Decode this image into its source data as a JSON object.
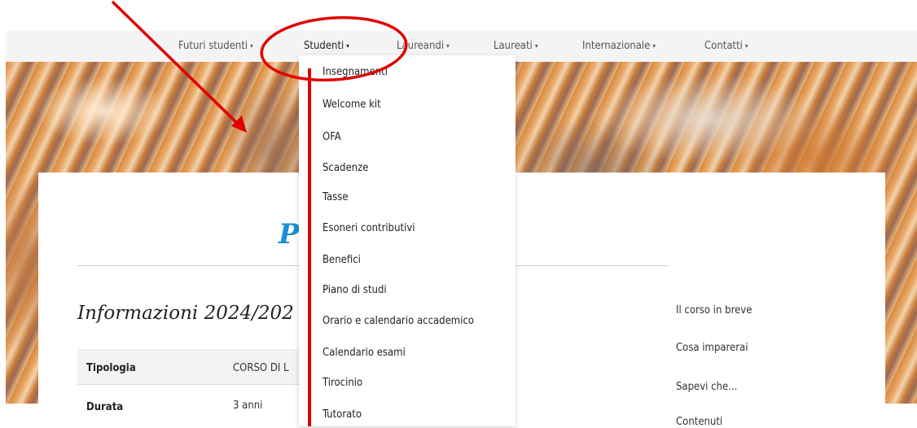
{
  "nav": {
    "items": [
      {
        "label": "Futuri studenti"
      },
      {
        "label": "Studenti"
      },
      {
        "label": "Laureandi"
      },
      {
        "label": "Laureati"
      },
      {
        "label": "Internazionale"
      },
      {
        "label": "Contatti"
      }
    ],
    "caret": "▾"
  },
  "dropdown": {
    "items": [
      "Insegnamenti",
      "Welcome kit",
      "OFA",
      "Scadenze",
      "Tasse",
      "Esoneri contributivi",
      "Benefici",
      "Piano di studi",
      "Orario e calendario accademico",
      "Calendario esami",
      "Tirocinio",
      "Tutorato"
    ]
  },
  "main": {
    "title_fragment": "P",
    "section_title": "Informazioni 2024/202",
    "info": [
      {
        "label": "Tipologia",
        "value": "CORSO DI L"
      },
      {
        "label": "Durata",
        "value": "3 anni"
      }
    ]
  },
  "side_nav": {
    "links": [
      "Il corso in breve",
      "Cosa imparerai",
      "Sapevi che...",
      "Contenuti"
    ]
  },
  "colors": {
    "annotation": "#e00000",
    "title_accent": "#1a8fd6",
    "nav_bg": "#f4f4f4"
  }
}
